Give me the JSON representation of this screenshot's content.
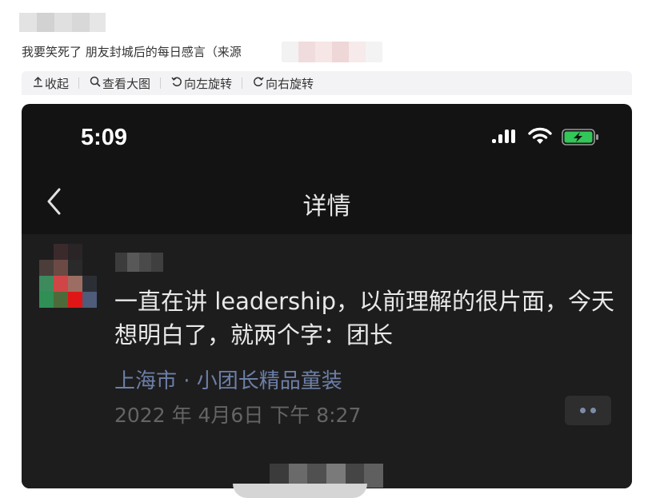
{
  "post": {
    "text": "我要笑死了 朋友封城后的每日感言（来源"
  },
  "toolbar": {
    "collapse_label": "收起",
    "view_large_label": "查看大图",
    "rotate_left_label": "向左旋转",
    "rotate_right_label": "向右旋转"
  },
  "phone": {
    "status_time": "5:09",
    "nav_title": "详情",
    "moment": {
      "text": "一直在讲 leadership，以前理解的很片面，今天想明白了，就两个字：团长",
      "location": "上海市 · 小团长精品童装",
      "timestamp": "2022 年 4月6日 下午 8:27"
    }
  },
  "icons": {
    "collapse": "arrow-up-icon",
    "view_large": "magnifier-icon",
    "rotate_left": "rotate-left-icon",
    "rotate_right": "rotate-right-icon",
    "back": "chevron-left-icon",
    "more": "more-dots-icon"
  },
  "colors": {
    "toolbar_bg": "#f3f3f5",
    "phone_bg": "#131313",
    "content_bg": "#1d1d1d",
    "location_link": "#6d7fa8",
    "battery_fill": "#33c759"
  }
}
